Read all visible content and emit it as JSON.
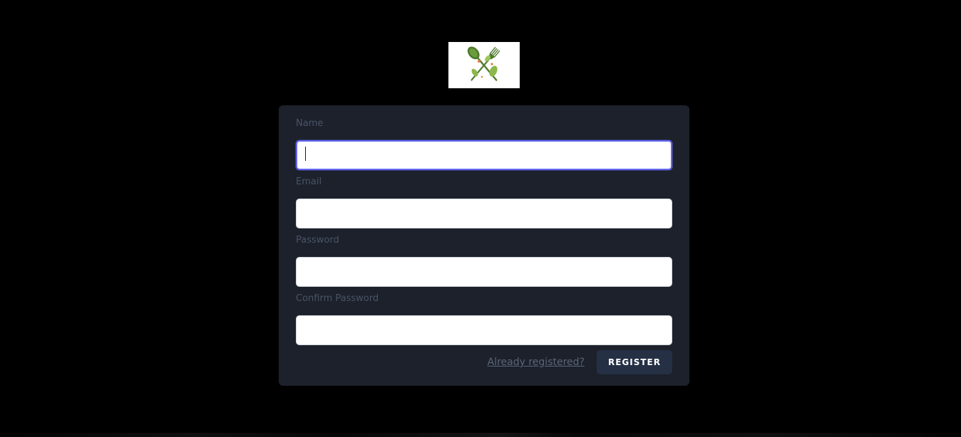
{
  "logo": {
    "icon": "spoon-fork-leaves-icon",
    "colors": {
      "utensil": "#5a8a3a",
      "leaf": "#8cb84a",
      "accent": "#e07a3a"
    }
  },
  "form": {
    "fields": [
      {
        "label": "Name",
        "value": "",
        "type": "text",
        "focused": true
      },
      {
        "label": "Email",
        "value": "",
        "type": "email",
        "focused": false
      },
      {
        "label": "Password",
        "value": "",
        "type": "password",
        "focused": false
      },
      {
        "label": "Confirm Password",
        "value": "",
        "type": "password",
        "focused": false
      }
    ],
    "login_link": "Already registered?",
    "submit_label": "Register"
  },
  "colors": {
    "page_bg": "#000000",
    "card_bg": "#1c212b",
    "focus_ring": "#6366f1",
    "button_bg": "#253045"
  }
}
